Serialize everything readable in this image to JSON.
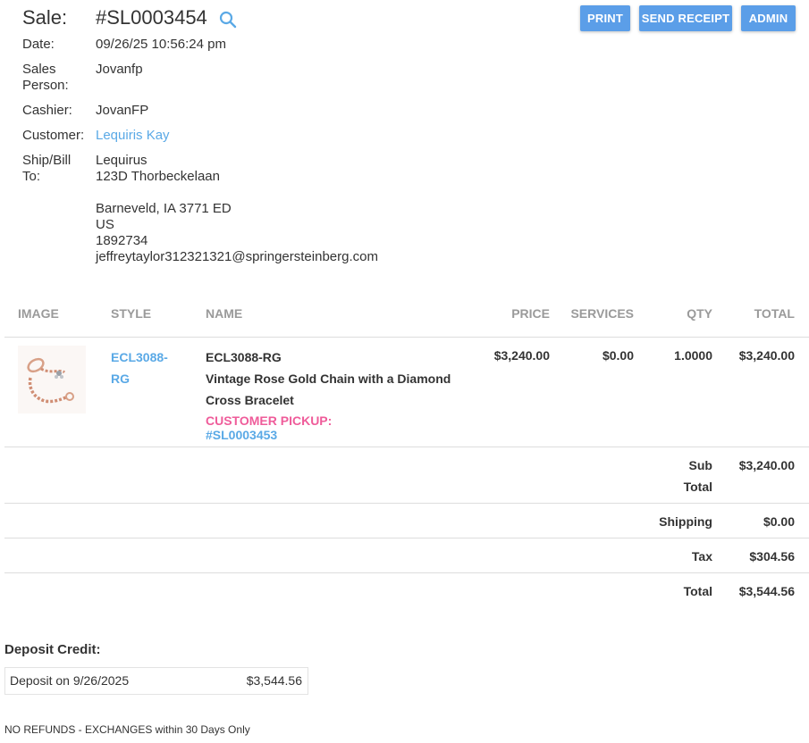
{
  "sale": {
    "label": "Sale:",
    "number": "#SL0003454"
  },
  "buttons": {
    "print": "PRINT",
    "send_receipt": "SEND RECEIPT",
    "admin": "ADMIN"
  },
  "info": {
    "date_label": "Date:",
    "date_value": "09/26/25 10:56:24 pm",
    "sales_person_label_1": "Sales",
    "sales_person_label_2": "Person:",
    "sales_person_value": "Jovanfp",
    "cashier_label": "Cashier:",
    "cashier_value": "JovanFP",
    "customer_label": "Customer:",
    "customer_value": "Lequiris Kay",
    "shipbill_label_1": "Ship/Bill",
    "shipbill_label_2": "To:",
    "address_name": "Lequirus",
    "address_line1": "123D Thorbeckelaan",
    "address_city": "Barneveld, IA 3771 ED",
    "address_country": "US",
    "address_phone": "1892734",
    "address_email": "jeffreytaylor312321321@springersteinberg.com"
  },
  "table": {
    "headers": {
      "image": "IMAGE",
      "style": "STYLE",
      "name": "NAME",
      "price": "PRICE",
      "services": "SERVICES",
      "qty": "QTY",
      "total": "TOTAL"
    },
    "rows": [
      {
        "style_line1": "ECL3088-",
        "style_line2": "RG",
        "name_code": "ECL3088-RG",
        "name_desc_1": "Vintage Rose Gold Chain with a Diamond",
        "name_desc_2": "Cross Bracelet",
        "pickup_label": "CUSTOMER PICKUP:",
        "pickup_ref": "#SL0003453",
        "price": "$3,240.00",
        "services": "$0.00",
        "qty": "1.0000",
        "total": "$3,240.00"
      }
    ]
  },
  "totals": {
    "subtotal_label_1": "Sub",
    "subtotal_label_2": "Total",
    "subtotal_value": "$3,240.00",
    "shipping_label": "Shipping",
    "shipping_value": "$0.00",
    "tax_label": "Tax",
    "tax_value": "$304.56",
    "total_label": "Total",
    "total_value": "$3,544.56"
  },
  "deposit": {
    "title": "Deposit Credit:",
    "label": "Deposit on 9/26/2025",
    "amount": "$3,544.56"
  },
  "policy": "NO REFUNDS - EXCHANGES within 30 Days Only",
  "colors": {
    "button": "#5b9ee8",
    "link": "#5aa9e6",
    "pickup": "#ef5c9a",
    "header_text": "#9a9a9a"
  }
}
